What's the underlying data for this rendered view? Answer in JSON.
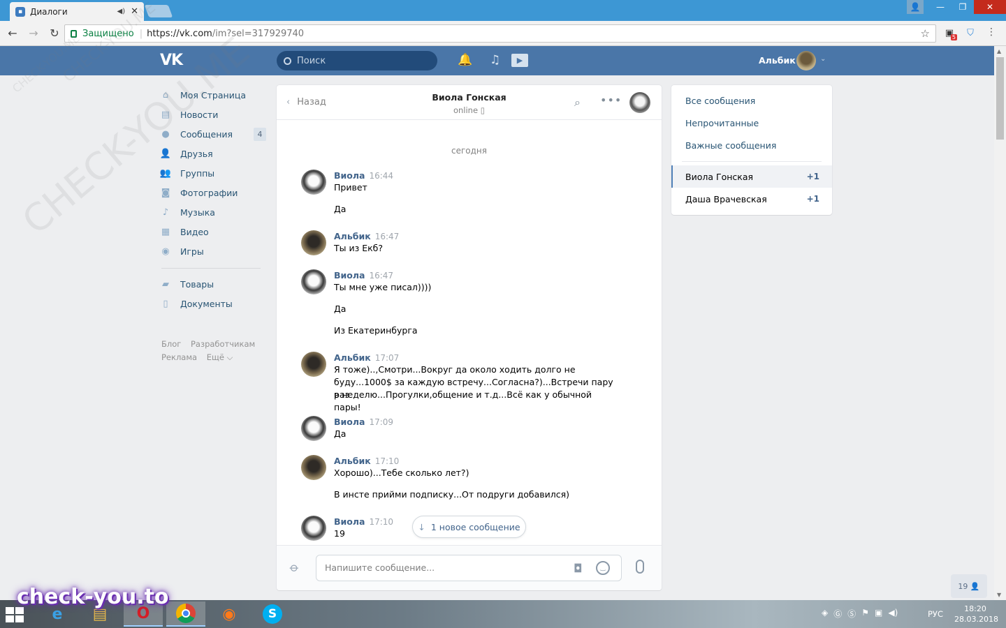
{
  "browser": {
    "tab_title": "Диалоги",
    "secure_label": "Защищено",
    "url_host": "https://vk.com",
    "url_path": "/im?sel=317929740",
    "ext_badge": "5"
  },
  "vk_header": {
    "logo": "VK",
    "search_placeholder": "Поиск",
    "user_name": "Альбик"
  },
  "left_menu": {
    "items": [
      {
        "label": "Моя Страница",
        "icon": "home-icon"
      },
      {
        "label": "Новости",
        "icon": "news-icon"
      },
      {
        "label": "Сообщения",
        "icon": "messages-icon",
        "count": "4"
      },
      {
        "label": "Друзья",
        "icon": "friend-icon"
      },
      {
        "label": "Группы",
        "icon": "groups-icon"
      },
      {
        "label": "Фотографии",
        "icon": "camera-icon"
      },
      {
        "label": "Музыка",
        "icon": "music-icon"
      },
      {
        "label": "Видео",
        "icon": "video-icon"
      },
      {
        "label": "Игры",
        "icon": "gamepad-icon"
      }
    ],
    "items2": [
      {
        "label": "Товары",
        "icon": "bag-icon"
      },
      {
        "label": "Документы",
        "icon": "document-icon"
      }
    ],
    "footer": {
      "blog": "Блог",
      "dev": "Разработчикам",
      "ads": "Реклама",
      "more": "Ещё ⌵"
    }
  },
  "chat": {
    "back_label": "Назад",
    "contact_name": "Виола Гонская",
    "contact_status": "online",
    "day_label": "сегодня",
    "new_message_label": "1 новое сообщение",
    "composer_placeholder": "Напишите сообщение...",
    "messages": [
      {
        "author": "Виола",
        "time": "16:44",
        "lines": [
          "Привет",
          "Да"
        ]
      },
      {
        "author": "Альбик",
        "time": "16:47",
        "lines": [
          "Ты из Екб?"
        ]
      },
      {
        "author": "Виола",
        "time": "16:47",
        "lines": [
          "Ты мне уже писал))))",
          "Да",
          "Из Екатеринбурга"
        ]
      },
      {
        "author": "Альбик",
        "time": "17:07",
        "lines": [
          "Я тоже)..,Смотри...Вокруг да около ходить долго не",
          "буду...1000$ за каждую встречу...Согласна?)...Встречи пару раз",
          "в неделю...Прогулки,общение и т.д...Всё как у обычной пары!"
        ]
      },
      {
        "author": "Виола",
        "time": "17:09",
        "lines": [
          "Да"
        ]
      },
      {
        "author": "Альбик",
        "time": "17:10",
        "lines": [
          "Хорошо)...Тебе сколько лет?)",
          "В инсте прийми подписку...От подруги добавился)"
        ]
      },
      {
        "author": "Виола",
        "time": "17:10",
        "lines": [
          "19"
        ]
      }
    ]
  },
  "right_panel": {
    "all": "Все сообщения",
    "unread": "Непрочитанные",
    "important": "Важные сообщения",
    "dialogs": [
      {
        "name": "Виола Гонская",
        "badge": "+1"
      },
      {
        "name": "Даша Врачевская",
        "badge": "+1"
      }
    ]
  },
  "online_counter": "19",
  "taskbar": {
    "lang": "РУС",
    "time": "18:20",
    "date": "28.03.2018"
  },
  "watermark": {
    "diagonal": "CHECK-YOU.ME",
    "brand": "check-you.to"
  }
}
